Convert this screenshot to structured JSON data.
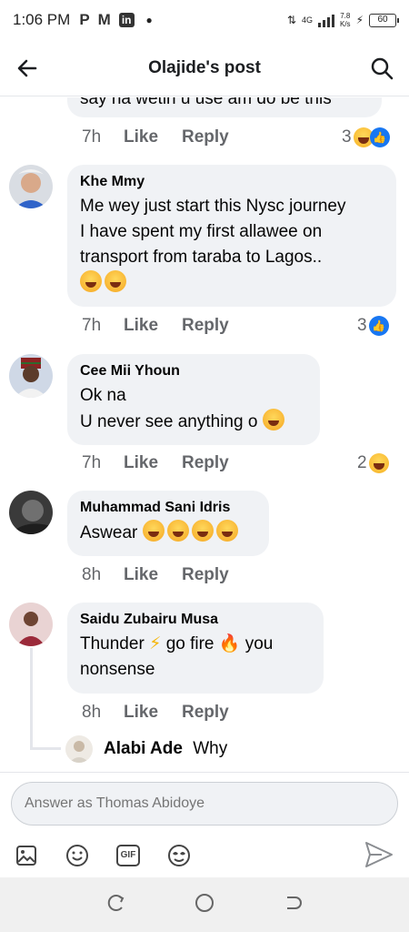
{
  "status": {
    "time": "1:06 PM",
    "apps": [
      "P",
      "M",
      "in"
    ],
    "net": "4G",
    "speed_top": "7.8",
    "speed_bottom": "K/s",
    "battery": "60"
  },
  "header": {
    "title": "Olajide's post"
  },
  "comments": [
    {
      "text": "say na wetin u use am do be this",
      "time": "7h",
      "like": "Like",
      "reply": "Reply",
      "reactions": "3"
    },
    {
      "author": "Khe Mmy",
      "text_lines": [
        "Me wey just start this Nysc journey",
        "I have spent my first allawee on",
        "transport from taraba to Lagos.."
      ],
      "time": "7h",
      "like": "Like",
      "reply": "Reply",
      "reactions": "3"
    },
    {
      "author": "Cee Mii Yhoun",
      "text_lines": [
        "Ok na",
        "U never see anything o"
      ],
      "time": "7h",
      "like": "Like",
      "reply": "Reply",
      "reactions": "2"
    },
    {
      "author": "Muhammad Sani Idris",
      "text": "Aswear",
      "time": "8h",
      "like": "Like",
      "reply": "Reply"
    },
    {
      "author": "Saidu Zubairu Musa",
      "text_a": "Thunder",
      "text_b": "go fire",
      "text_c": "you",
      "text_d": "nonsense",
      "time": "8h",
      "like": "Like",
      "reply": "Reply"
    },
    {
      "author": "Alabi Ade",
      "text": "Why"
    }
  ],
  "composer": {
    "placeholder": "Answer as Thomas Abidoye",
    "gif_label": "GIF"
  },
  "colors": {
    "accent": "#1877f2",
    "bubble": "#f0f2f5",
    "meta": "#65676b"
  }
}
